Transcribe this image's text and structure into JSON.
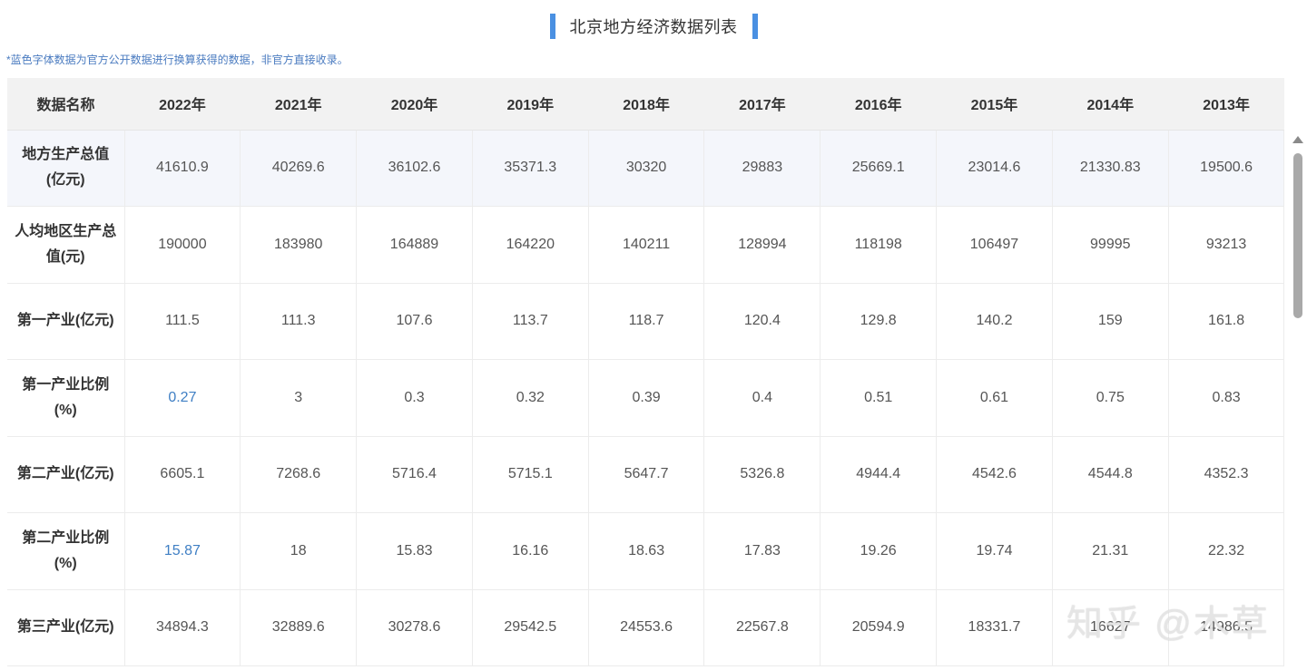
{
  "title": "北京地方经济数据列表",
  "note": "*蓝色字体数据为官方公开数据进行换算获得的数据，非官方直接收录。",
  "table": {
    "header": [
      "数据名称",
      "2022年",
      "2021年",
      "2020年",
      "2019年",
      "2018年",
      "2017年",
      "2016年",
      "2015年",
      "2014年",
      "2013年"
    ],
    "rows": [
      {
        "name": "地方生产总值(亿元)",
        "values": [
          "41610.9",
          "40269.6",
          "36102.6",
          "35371.3",
          "30320",
          "29883",
          "25669.1",
          "23014.6",
          "21330.83",
          "19500.6"
        ]
      },
      {
        "name": "人均地区生产总值(元)",
        "values": [
          "190000",
          "183980",
          "164889",
          "164220",
          "140211",
          "128994",
          "118198",
          "106497",
          "99995",
          "93213"
        ]
      },
      {
        "name": "第一产业(亿元)",
        "values": [
          "111.5",
          "111.3",
          "107.6",
          "113.7",
          "118.7",
          "120.4",
          "129.8",
          "140.2",
          "159",
          "161.8"
        ]
      },
      {
        "name": "第一产业比例(%)",
        "values": [
          "0.27",
          "3",
          "0.3",
          "0.32",
          "0.39",
          "0.4",
          "0.51",
          "0.61",
          "0.75",
          "0.83"
        ],
        "blue": [
          0
        ]
      },
      {
        "name": "第二产业(亿元)",
        "values": [
          "6605.1",
          "7268.6",
          "5716.4",
          "5715.1",
          "5647.7",
          "5326.8",
          "4944.4",
          "4542.6",
          "4544.8",
          "4352.3"
        ]
      },
      {
        "name": "第二产业比例(%)",
        "values": [
          "15.87",
          "18",
          "15.83",
          "16.16",
          "18.63",
          "17.83",
          "19.26",
          "19.74",
          "21.31",
          "22.32"
        ],
        "blue": [
          0
        ]
      },
      {
        "name": "第三产业(亿元)",
        "values": [
          "34894.3",
          "32889.6",
          "30278.6",
          "29542.5",
          "24553.6",
          "22567.8",
          "20594.9",
          "18331.7",
          "16627",
          "14986.5"
        ]
      }
    ]
  },
  "watermark": "知乎 @木草",
  "colors": {
    "accent": "#4a90e2",
    "blue_value": "#3f7fc4",
    "header_bg": "#f2f2f2"
  }
}
